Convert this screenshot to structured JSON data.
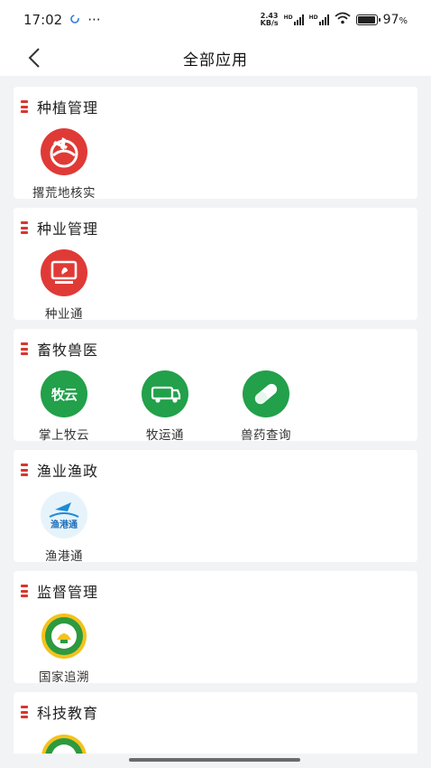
{
  "status": {
    "time": "17:02",
    "dots": "···",
    "speed_top": "2.43",
    "speed_bottom": "KB/s",
    "hd1": "HD",
    "hd2": "HD",
    "battery_pct": "97",
    "battery_unit": "%"
  },
  "nav": {
    "title": "全部应用"
  },
  "colors": {
    "accent": "#d9362e",
    "green": "#22a04a",
    "red": "#e03a36"
  },
  "sections": [
    {
      "title": "种植管理",
      "apps": [
        {
          "label": "撂荒地核实",
          "icon": "globe-plane-icon"
        }
      ]
    },
    {
      "title": "种业管理",
      "apps": [
        {
          "label": "种业通",
          "icon": "monitor-leaf-icon"
        }
      ]
    },
    {
      "title": "畜牧兽医",
      "apps": [
        {
          "label": "掌上牧云",
          "icon": "muyun-logo-icon",
          "icon_text": "牧云"
        },
        {
          "label": "牧运通",
          "icon": "truck-icon"
        },
        {
          "label": "兽药查询",
          "icon": "capsule-icon"
        }
      ]
    },
    {
      "title": "渔业渔政",
      "apps": [
        {
          "label": "渔港通",
          "icon": "fishing-port-logo-icon",
          "icon_text": "渔港通"
        }
      ]
    },
    {
      "title": "监督管理",
      "apps": [
        {
          "label": "国家追溯",
          "icon": "traceability-seal-icon"
        }
      ]
    },
    {
      "title": "科技教育",
      "apps": [
        {
          "label": "",
          "icon": "education-seal-icon"
        }
      ]
    }
  ]
}
